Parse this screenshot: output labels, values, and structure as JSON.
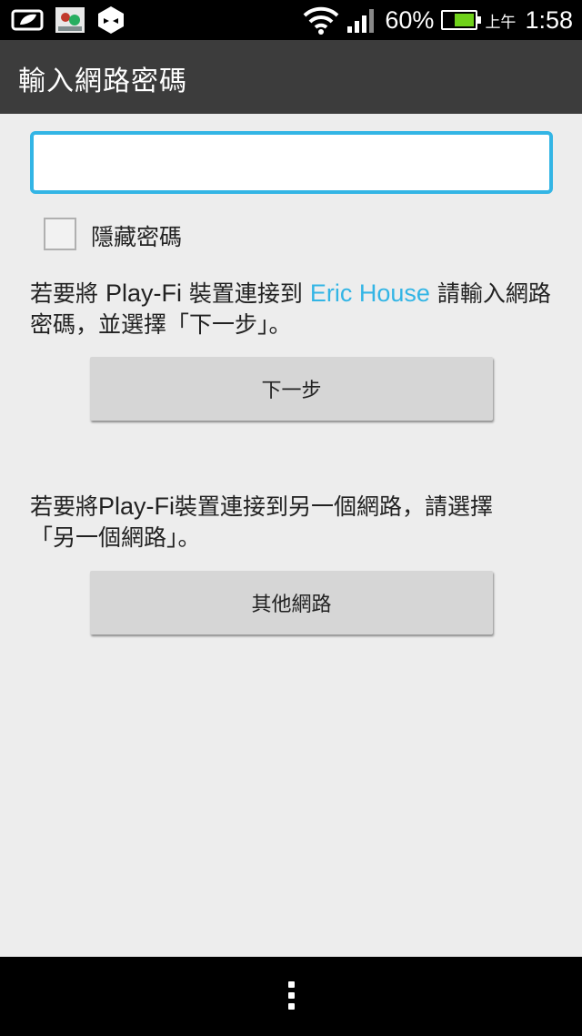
{
  "status_bar": {
    "icons_left": [
      "leaf-notification-icon",
      "photo-notification-icon",
      "hexagon-app-icon"
    ],
    "battery_percent": "60%",
    "battery_level": 0.6,
    "battery_color": "#6fd11a",
    "am_pm": "上午",
    "time": "1:58"
  },
  "app_bar": {
    "title": "輸入網路密碼"
  },
  "password": {
    "value": "",
    "placeholder": ""
  },
  "hide_password": {
    "label": "隱藏密碼",
    "checked": false
  },
  "message_current": {
    "part1": "若要將 ",
    "brand": "Play-Fi",
    "part2": " 裝置連接到 ",
    "network": "Eric House",
    "part3": " 請輸入網路密碼，並選擇「下一步」。"
  },
  "next_button": {
    "label": "下一步"
  },
  "message_other": {
    "part1": "若要將",
    "brand": "Play-Fi",
    "part2": "裝置連接到另一個網路，請選擇「另一個網路」。"
  },
  "other_button": {
    "label": "其他網路"
  },
  "colors": {
    "accent": "#33b5e5",
    "app_bar": "#3c3c3c",
    "background": "#ededed"
  }
}
